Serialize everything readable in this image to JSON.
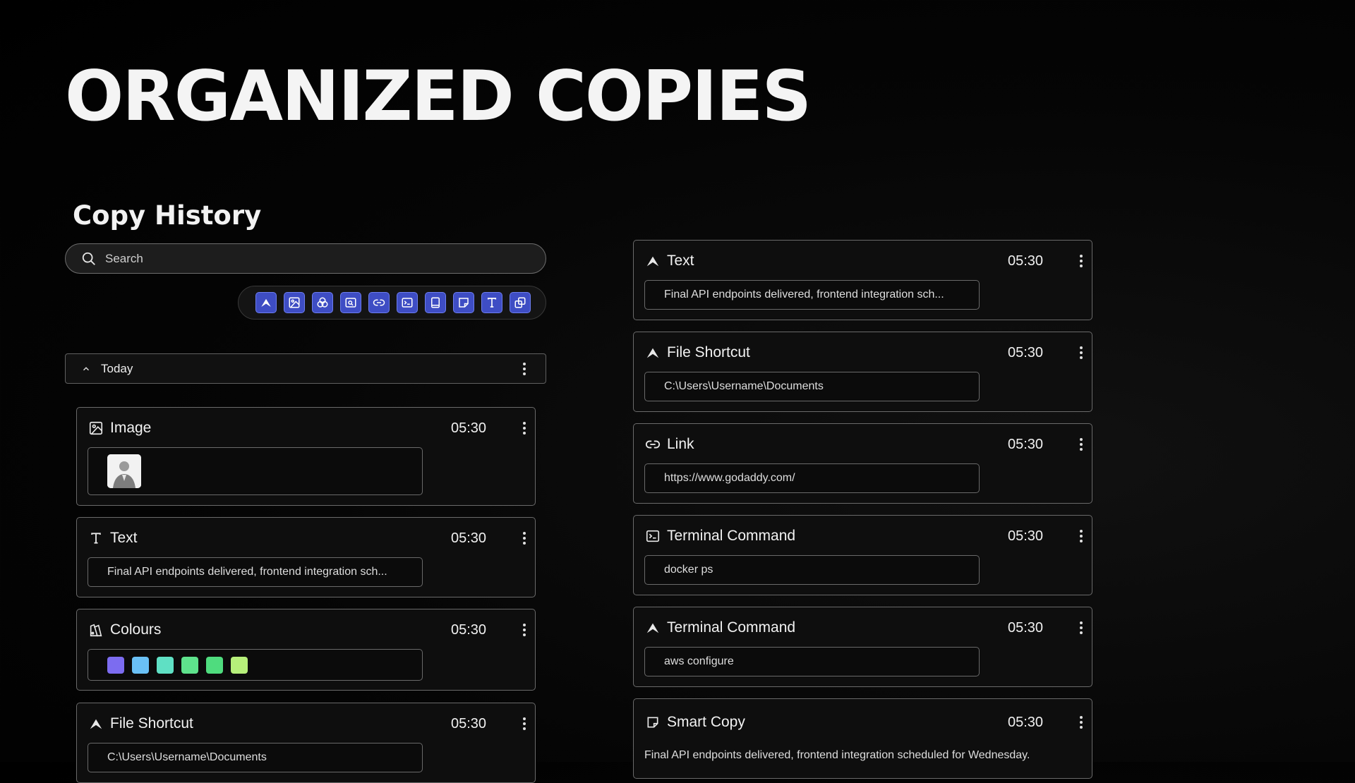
{
  "page": {
    "hero_title": "ORGANIZED COPIES"
  },
  "history": {
    "title": "Copy History",
    "search": {
      "placeholder": "Search",
      "icon": "search-icon"
    },
    "filters": [
      {
        "name": "filter-smart-button",
        "icon": "smart-icon"
      },
      {
        "name": "filter-image-button",
        "icon": "image-icon"
      },
      {
        "name": "filter-colours-button",
        "icon": "colours-icon"
      },
      {
        "name": "filter-screenshot-button",
        "icon": "screenshot-icon"
      },
      {
        "name": "filter-link-button",
        "icon": "link-icon"
      },
      {
        "name": "filter-terminal-button",
        "icon": "terminal-icon"
      },
      {
        "name": "filter-file-button",
        "icon": "file-icon"
      },
      {
        "name": "filter-note-button",
        "icon": "note-icon"
      },
      {
        "name": "filter-text-button",
        "icon": "text-icon"
      },
      {
        "name": "filter-copy-button",
        "icon": "copy-icon"
      }
    ],
    "filter_color": "#3e4dc4",
    "group": {
      "label": "Today"
    }
  },
  "left_cards": [
    {
      "type": "image",
      "title": "Image",
      "time": "05:30",
      "icon": "image-icon"
    },
    {
      "type": "text",
      "title": "Text",
      "time": "05:30",
      "icon": "text-icon",
      "content": "Final API endpoints delivered, frontend integration sch..."
    },
    {
      "type": "colours",
      "title": "Colours",
      "time": "05:30",
      "icon": "palette-icon",
      "colors": [
        "#7c6cf0",
        "#6ac0f5",
        "#5fe0c4",
        "#5ee28c",
        "#4fdc7e",
        "#b6ef7a"
      ]
    },
    {
      "type": "file",
      "title": "File Shortcut",
      "time": "05:30",
      "icon": "smart-icon",
      "content": "C:\\Users\\Username\\Documents"
    }
  ],
  "right_cards": [
    {
      "title": "Text",
      "time": "05:30",
      "icon": "smart-icon",
      "content": "Final API endpoints delivered, frontend integration sch..."
    },
    {
      "title": "File Shortcut",
      "time": "05:30",
      "icon": "smart-icon",
      "content": "C:\\Users\\Username\\Documents"
    },
    {
      "title": "Link",
      "time": "05:30",
      "icon": "link-icon",
      "content": "https://www.godaddy.com/"
    },
    {
      "title": "Terminal Command",
      "time": "05:30",
      "icon": "terminal-icon",
      "content": "docker ps"
    },
    {
      "title": "Terminal Command",
      "time": "05:30",
      "icon": "smart-icon",
      "content": "aws configure"
    },
    {
      "title": "Smart Copy",
      "time": "05:30",
      "icon": "note-icon",
      "content": "Final API endpoints delivered, frontend integration scheduled for Wednesday."
    }
  ]
}
